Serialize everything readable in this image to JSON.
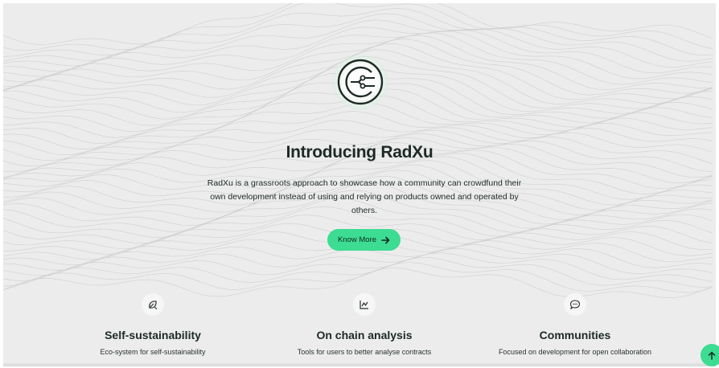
{
  "hero": {
    "logo_icon": "circuit-logo-icon",
    "title": "Introducing RadXu",
    "description": "RadXu is a grassroots approach to showcase how a community can crowdfund their own development instead of using and relying on products owned and operated by others.",
    "cta_label": "Know More",
    "cta_icon": "arrow-right-icon"
  },
  "features": [
    {
      "icon": "leaf-icon",
      "title": "Self-sustainability",
      "description": "Eco-system for self-sustainability"
    },
    {
      "icon": "line-chart-icon",
      "title": "On chain analysis",
      "description": "Tools for users to better analyse contracts"
    },
    {
      "icon": "chat-bubble-icon",
      "title": "Communities",
      "description": "Focused on development for open collaboration"
    }
  ],
  "scroll_top_icon": "arrow-up-icon",
  "colors": {
    "accent": "#3ddc93",
    "background": "#ececec",
    "text": "#1d2a24"
  }
}
